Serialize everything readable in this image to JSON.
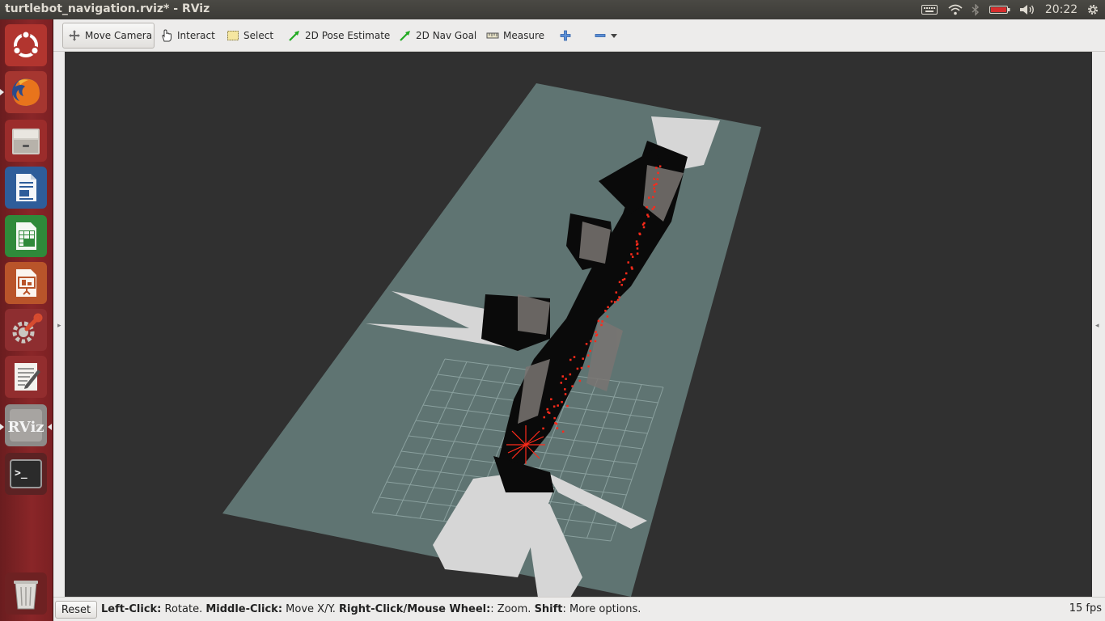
{
  "window": {
    "title": "turtlebot_navigation.rviz* - RViz"
  },
  "panel": {
    "clock": "20:22"
  },
  "launcher": {
    "items": [
      {
        "name": "ubuntu-dash",
        "icon": "ubuntu-logo-icon"
      },
      {
        "name": "firefox",
        "icon": "firefox-icon"
      },
      {
        "name": "files",
        "icon": "file-cabinet-icon"
      },
      {
        "name": "writer",
        "icon": "libreoffice-writer-icon"
      },
      {
        "name": "calc",
        "icon": "libreoffice-calc-icon"
      },
      {
        "name": "impress",
        "icon": "libreoffice-impress-icon"
      },
      {
        "name": "settings",
        "icon": "system-settings-icon"
      },
      {
        "name": "text-editor",
        "icon": "text-editor-icon"
      },
      {
        "name": "rviz",
        "icon": "rviz-icon",
        "label": "RViz"
      },
      {
        "name": "terminal",
        "icon": "terminal-icon",
        "label": ">_"
      },
      {
        "name": "trash",
        "icon": "trash-icon"
      }
    ]
  },
  "toolbar": {
    "tools": [
      {
        "id": "move-camera",
        "label": "Move Camera",
        "icon": "move-camera-icon",
        "active": true
      },
      {
        "id": "interact",
        "label": "Interact",
        "icon": "hand-icon"
      },
      {
        "id": "select",
        "label": "Select",
        "icon": "select-rectangle-icon"
      },
      {
        "id": "pose-estimate",
        "label": "2D Pose Estimate",
        "icon": "green-arrow-icon"
      },
      {
        "id": "nav-goal",
        "label": "2D Nav Goal",
        "icon": "green-arrow-icon"
      },
      {
        "id": "measure",
        "label": "Measure",
        "icon": "ruler-icon"
      }
    ],
    "add_icon": "plus-icon",
    "remove_icon": "minus-icon"
  },
  "status": {
    "reset_label": "Reset",
    "hint_parts": [
      {
        "bold": "Left-Click:",
        "text": " Rotate. "
      },
      {
        "bold": "Middle-Click:",
        "text": " Move X/Y. "
      },
      {
        "bold": "Right-Click/Mouse Wheel:",
        "text": ": Zoom. "
      },
      {
        "bold": "Shift",
        "text": ": More options."
      }
    ],
    "fps": "15 fps"
  },
  "colors": {
    "launcher": "#8a2628",
    "viewport_bg": "#303030",
    "map_plane": "#5f7472",
    "laser_points": "#ff2a1a",
    "nav_arrow": "#22aa22"
  }
}
